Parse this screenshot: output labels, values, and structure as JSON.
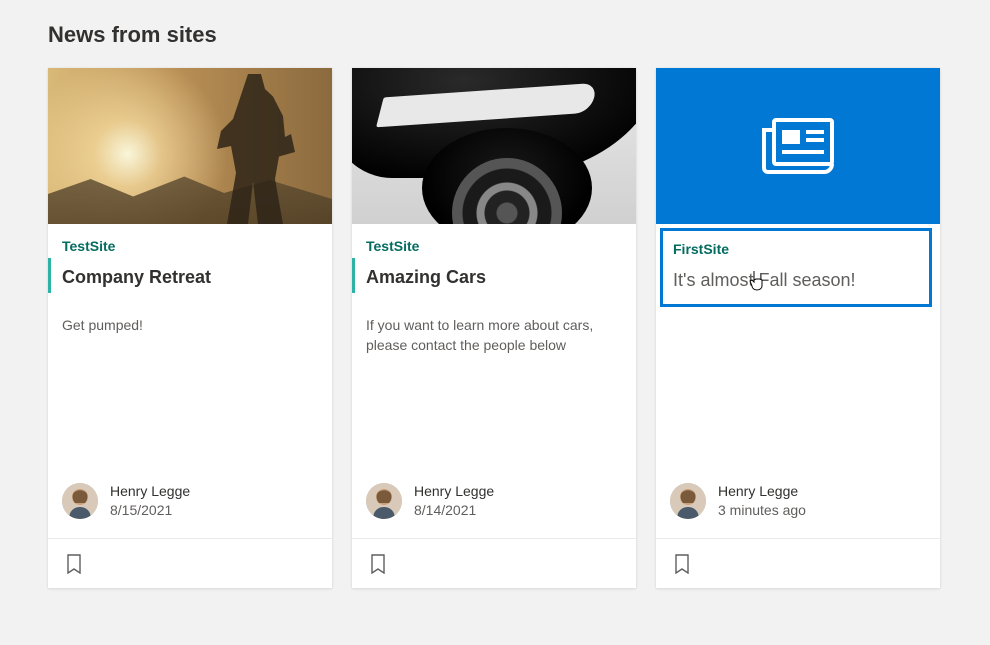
{
  "section_title": "News from sites",
  "cards": [
    {
      "site": "TestSite",
      "title": "Company Retreat",
      "description": "Get pumped!",
      "author": "Henry Legge",
      "timestamp": "8/15/2021",
      "hero": "retreat",
      "selected": false
    },
    {
      "site": "TestSite",
      "title": "Amazing Cars",
      "description": "If you want to learn more about cars, please contact the people below",
      "author": "Henry Legge",
      "timestamp": "8/14/2021",
      "hero": "car",
      "selected": false
    },
    {
      "site": "FirstSite",
      "title": "It's almost Fall season!",
      "description": "",
      "author": "Henry Legge",
      "timestamp": "3 minutes ago",
      "hero": "placeholder",
      "selected": true
    }
  ]
}
